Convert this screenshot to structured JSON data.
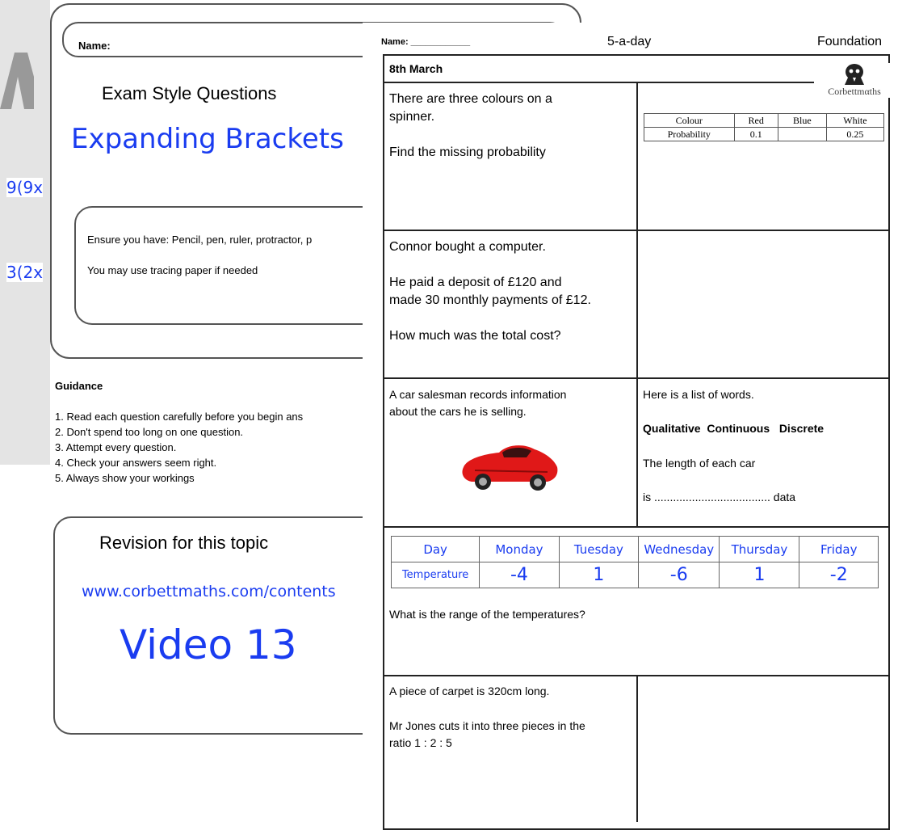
{
  "back_sheet": {
    "name_label": "Name:",
    "subtitle": "Exam Style Questions",
    "title": "Expanding Brackets",
    "side_fragments": [
      "9(9x",
      "3(2x"
    ],
    "ensure_text": "Ensure you have: Pencil, pen, ruler, protractor, p",
    "tracing_text": "You may use tracing paper if needed",
    "guidance": {
      "heading": "Guidance",
      "items": [
        "1. Read each question carefully before you begin ans",
        "2. Don't spend too long on one question.",
        "3. Attempt every question.",
        "4. Check your answers seem right.",
        "5. Always show your workings"
      ]
    },
    "revision": {
      "heading": "Revision for this topic",
      "url": "www.corbettmaths.com/contents",
      "video": "Video 13"
    }
  },
  "front_sheet": {
    "name_label": "Name: ____________",
    "title": "5-a-day",
    "level": "Foundation",
    "date": "8th March",
    "logo_text": "Corbettmαths",
    "q1": {
      "line1": "There are three colours on a",
      "line2": "spinner.",
      "line3": "Find the missing probability",
      "table": {
        "headers": [
          "Colour",
          "Red",
          "Blue",
          "White"
        ],
        "row": [
          "Probability",
          "0.1",
          "",
          "0.25"
        ]
      }
    },
    "q2": {
      "line1": "Connor bought a computer.",
      "line2": "He paid a deposit of £120 and",
      "line3": "made 30 monthly payments of £12.",
      "line4": "How much was the total cost?"
    },
    "q3": {
      "line1": "A car salesman records information",
      "line2": "about the cars he is selling.",
      "list_intro": "Here is a list of words.",
      "words": [
        "Qualitative",
        "Continuous",
        "Discrete"
      ],
      "statement": "The length of each car",
      "answer_line": "is ..................................... data"
    },
    "q4": {
      "headers": [
        "Day",
        "Monday",
        "Tuesday",
        "Wednesday",
        "Thursday",
        "Friday"
      ],
      "row_label": "Temperature",
      "values": [
        "-4",
        "1",
        "-6",
        "1",
        "-2"
      ],
      "question": "What is the range of the temperatures?"
    },
    "q5": {
      "line1": "A piece of carpet is 320cm long.",
      "line2": "Mr Jones cuts it into three pieces in the",
      "line3": "ratio 1 : 2 : 5"
    }
  },
  "colors": {
    "handwriting_blue": "#1a3cf0",
    "car_red": "#e01818"
  }
}
